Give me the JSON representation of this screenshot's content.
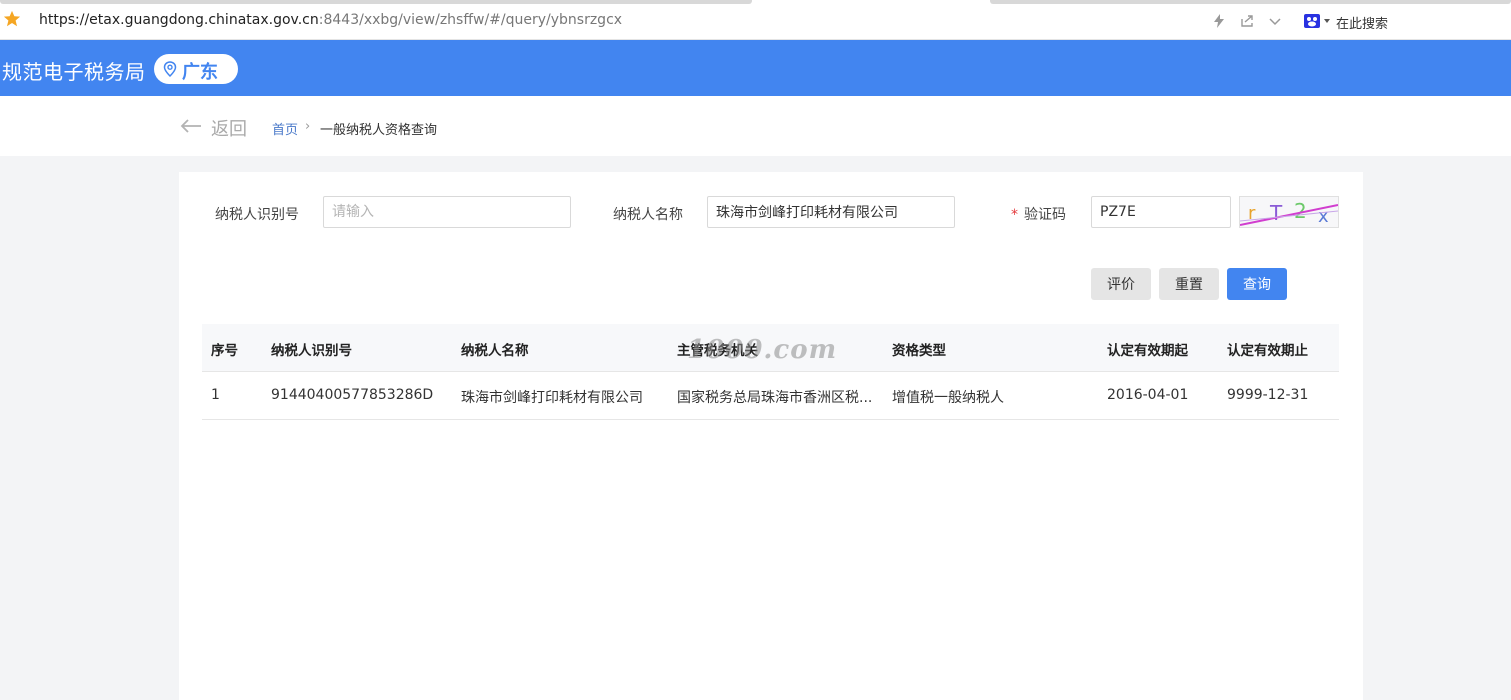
{
  "browser": {
    "url_host": "https://etax.guangdong.chinatax.gov.cn",
    "url_rest": ":8443/xxbg/view/zhsffw/#/query/ybnsrzgcx",
    "search_label": "在此搜索"
  },
  "header": {
    "title": "规范电子税务局",
    "province": "广东",
    "color": "#4285f0"
  },
  "breadcrumb": {
    "back_label": "返回",
    "home": "首页",
    "current": "一般纳税人资格查询"
  },
  "form": {
    "taxpayer_id_label": "纳税人识别号",
    "taxpayer_id_placeholder": "请输入",
    "taxpayer_id_value": "",
    "taxpayer_name_label": "纳税人名称",
    "taxpayer_name_value": "珠海市剑峰打印耗材有限公司",
    "captcha_required": "*",
    "captcha_label": "验证码",
    "captcha_value": "PZ7E",
    "captcha_image_text": "r T 2 x"
  },
  "buttons": {
    "evaluate": "评价",
    "reset": "重置",
    "query": "查询"
  },
  "table": {
    "headers": [
      "序号",
      "纳税人识别号",
      "纳税人名称",
      "主管税务机关",
      "资格类型",
      "认定有效期起",
      "认定有效期止"
    ],
    "rows": [
      [
        "1",
        "91440400577853286D",
        "珠海市剑峰打印耗材有限公司",
        "国家税务总局珠海市香洲区税...",
        "增值税一般纳税人",
        "2016-04-01",
        "9999-12-31"
      ]
    ]
  },
  "watermark": "1000.com"
}
